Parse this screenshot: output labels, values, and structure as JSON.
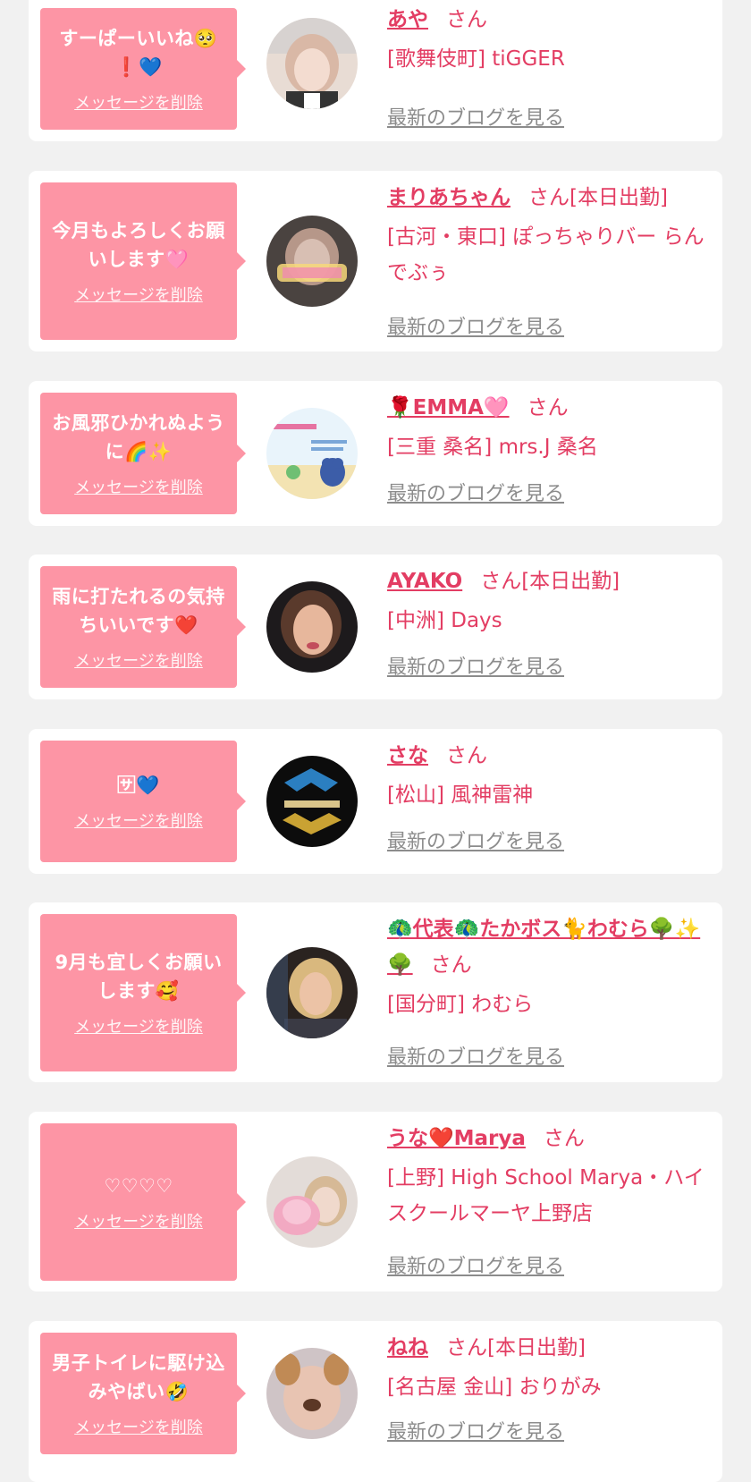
{
  "delete_label": "メッセージを削除",
  "blog_label": "最新のブログを見る",
  "san_label": "さん",
  "colors": {
    "page_bg": "#f1f1f1",
    "bubble_bg": "#fd95a5",
    "accent": "#e33d63",
    "link_gray": "#8c8c8c"
  },
  "entries": [
    {
      "message": "すーぱーいいね🥺❗💙",
      "name": "あや",
      "status": "",
      "shop": "[歌舞伎町] tiGGER",
      "avatar_icon": "avatar-photo"
    },
    {
      "message": "今月もよろしくお願いします🩷",
      "name": "まりあちゃん",
      "status": "[本日出勤]",
      "shop": "[古河・東口] ぽっちゃりバー らんでぶぅ",
      "avatar_icon": "avatar-photo"
    },
    {
      "message": "お風邪ひかれぬように🌈✨",
      "name": "🌹EMMA🩷",
      "status": "",
      "shop": "[三重 桑名] mrs.J 桑名",
      "avatar_icon": "avatar-illustration"
    },
    {
      "message": "雨に打たれるの気持ちいいです❤️",
      "name": "AYAKO",
      "status": "[本日出勤]",
      "shop": "[中洲] Days",
      "avatar_icon": "avatar-photo"
    },
    {
      "message": "🈂💙",
      "name": "さな",
      "status": "",
      "shop": "[松山] 風神雷神",
      "avatar_icon": "avatar-logo"
    },
    {
      "message": "9月も宜しくお願いします🥰",
      "name": "🦚代表🦚たかボス🐈わむら🌳✨🌳",
      "status": "",
      "shop": "[国分町] わむら",
      "avatar_icon": "avatar-photo"
    },
    {
      "message": "♡♡♡♡",
      "name": "うな❤️Marya",
      "status": "",
      "shop": "[上野] High School Marya・ハイスクールマーヤ上野店",
      "avatar_icon": "avatar-photo"
    },
    {
      "message": "男子トイレに駆け込みやばい🤣",
      "name": "ねね",
      "status": "[本日出勤]",
      "shop": "[名古屋 金山] おりがみ",
      "avatar_icon": "avatar-photo"
    }
  ]
}
